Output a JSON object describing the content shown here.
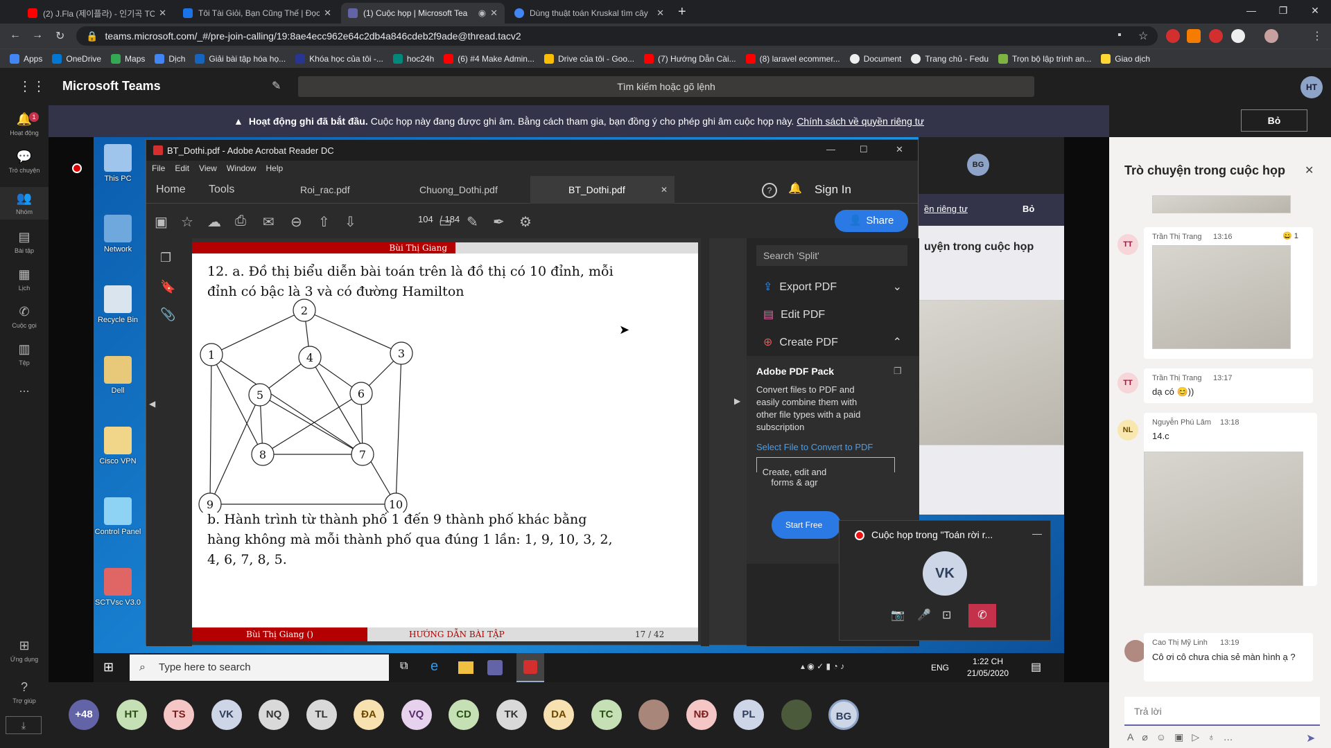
{
  "browser": {
    "tabs": [
      {
        "title": "(2) J.Fla (제이플라) - 인기곡 TOP",
        "icon": "youtube-icon",
        "color": "#ff0000"
      },
      {
        "title": "Tôi Tài Giỏi, Bạn Cũng Thế | Đọc",
        "icon": "s-site-icon",
        "color": "#1a73e8"
      },
      {
        "title": "(1) Cuộc họp | Microsoft Tea",
        "icon": "teams-icon",
        "color": "#6264a7"
      },
      {
        "title": "Dùng thuật toán Kruskal tìm cây",
        "icon": "google-icon",
        "color": "#4285f4"
      }
    ],
    "url": "teams.microsoft.com/_#/pre-join-calling/19:8ae4ecc962e64c2db4a846cdeb2f9ade@thread.tacv2",
    "bookmarks": [
      "Apps",
      "OneDrive",
      "Maps",
      "Dịch",
      "Giải bài tập hóa họ...",
      "Khóa học của tôi -...",
      "hoc24h",
      "(6) #4 Make Admin...",
      "Drive của tôi - Goo...",
      "(7) Hướng Dẫn Cài...",
      "(8) laravel ecommer...",
      "Document",
      "Trang chủ - Fedu",
      "Trọn bộ lập trình an...",
      "Giao dịch"
    ]
  },
  "teams": {
    "app_title": "Microsoft Teams",
    "search_placeholder": "Tìm kiếm hoặc gõ lệnh",
    "user_initials": "HT",
    "banner": {
      "bold": "Hoạt động ghi đã bắt đầu.",
      "text": "Cuộc họp này đang được ghi âm. Bằng cách tham gia, bạn đồng ý cho phép ghi âm cuộc họp này.",
      "link": "Chính sách về quyền riêng tư",
      "dismiss": "Bỏ"
    },
    "rail": [
      {
        "label": "Hoạt động",
        "badge": "1"
      },
      {
        "label": "Trò chuyện"
      },
      {
        "label": "Nhóm"
      },
      {
        "label": "Bài tập"
      },
      {
        "label": "Lịch"
      },
      {
        "label": "Cuộc gọi"
      },
      {
        "label": "Tệp"
      },
      {
        "label": "..."
      },
      {
        "label": "Ứng dụng"
      },
      {
        "label": "Trợ giúp"
      }
    ]
  },
  "desktop": {
    "icons": [
      "This PC",
      "Network",
      "Recycle Bin",
      "Dell",
      "Cisco VPN",
      "Control Panel",
      "SCTVsc V3.0"
    ]
  },
  "acrobat": {
    "window_title": "BT_Dothi.pdf - Adobe Acrobat Reader DC",
    "menu": [
      "File",
      "Edit",
      "View",
      "Window",
      "Help"
    ],
    "tabs": [
      "Home",
      "Tools",
      "Roi_rac.pdf",
      "Chuong_Dothi.pdf",
      "BT_Dothi.pdf"
    ],
    "sign_in": "Sign In",
    "share": "Share",
    "page_current": "104",
    "page_total": "/ 184",
    "page": {
      "header": "Bùi Thị Giang",
      "text_a": "12. a. Đồ thị biểu diễn bài toán trên là đồ thị có 10 đỉnh, mỗi đỉnh có bậc là 3 và có đường Hamilton",
      "text_b": "b. Hành trình từ thành phố 1 đến 9 thành phố khác bằng hàng không mà mỗi thành phố qua đúng 1 lần: 1, 9, 10, 3, 2, 4, 6, 7, 8, 5.",
      "footer_author": "Bùi Thị Giang ()",
      "footer_title": "HƯỚNG DẪN BÀI TẬP",
      "footer_page": "17 / 42",
      "nodes": [
        "2",
        "1",
        "4",
        "3",
        "5",
        "6",
        "8",
        "7",
        "9",
        "10"
      ]
    },
    "right_pane": {
      "search_placeholder": "Search 'Split'",
      "items": [
        "Export PDF",
        "Edit PDF",
        "Create PDF"
      ],
      "pack_title": "Adobe PDF Pack",
      "pack_text": "Convert files to PDF and easily combine them with other file types with a paid subscription",
      "select_link": "Select File to Convert to PDF",
      "bottom_text": "Create, edit and forms & agr",
      "start_button": "Start Free"
    }
  },
  "minicall": {
    "title": "Cuộc họp trong \"Toán rời r...",
    "initials": "VK"
  },
  "bg_meeting": {
    "privacy_link": "ền riêng tư",
    "dismiss": "Bỏ",
    "chat_title": "uyện trong cuộc họp",
    "avatar": "BG"
  },
  "taskbar": {
    "search": "Type here to search",
    "lang": "ENG",
    "time": "1:22 CH",
    "date": "21/05/2020"
  },
  "chat": {
    "title": "Trò chuyện trong cuộc họp",
    "messages": [
      {
        "initials": "TT",
        "name": "Trần Thị Trang",
        "time": "13:16",
        "reaction": "1",
        "text": ""
      },
      {
        "initials": "TT",
        "name": "Trần Thị Trang",
        "time": "13:17",
        "reaction": "",
        "text": "dạ có"
      },
      {
        "initials": "NL",
        "name": "Nguyễn Phú Lâm",
        "time": "13:18",
        "reaction": "",
        "text": "14.c"
      },
      {
        "initials": "",
        "name": "Cao Thị Mỹ Linh",
        "time": "13:19",
        "reaction": "",
        "text": "Cô ơi cô chưa chia sẻ màn hình ạ ?"
      }
    ],
    "reply_placeholder": "Trả lời"
  },
  "participants": [
    {
      "label": "+48",
      "bg": "#6264a7",
      "fg": "#ffffff"
    },
    {
      "label": "HT",
      "bg": "#c5e0b4",
      "fg": "#2b5016"
    },
    {
      "label": "TS",
      "bg": "#f4c6c6",
      "fg": "#7a1f1f"
    },
    {
      "label": "VK",
      "bg": "#cdd6e6",
      "fg": "#2f3e5c"
    },
    {
      "label": "NQ",
      "bg": "#d9d9d9",
      "fg": "#333333"
    },
    {
      "label": "TL",
      "bg": "#d9d9d9",
      "fg": "#333333"
    },
    {
      "label": "ĐA",
      "bg": "#f8e1b0",
      "fg": "#6b4a00"
    },
    {
      "label": "VQ",
      "bg": "#e6d2ec",
      "fg": "#5a2b6b"
    },
    {
      "label": "CD",
      "bg": "#c5e0b4",
      "fg": "#2b5016"
    },
    {
      "label": "TK",
      "bg": "#d9d9d9",
      "fg": "#333333"
    },
    {
      "label": "DA",
      "bg": "#f8e1b0",
      "fg": "#6b4a00"
    },
    {
      "label": "TC",
      "bg": "#c5e0b4",
      "fg": "#2b5016"
    },
    {
      "label": "",
      "bg": "#a8877a",
      "fg": "#ffffff"
    },
    {
      "label": "NĐ",
      "bg": "#f4c6c6",
      "fg": "#7a1f1f"
    },
    {
      "label": "PL",
      "bg": "#cdd6e6",
      "fg": "#2f3e5c"
    },
    {
      "label": "",
      "bg": "#4a5a3a",
      "fg": "#ffffff"
    },
    {
      "label": "BG",
      "bg": "#cdd6e6",
      "fg": "#2f3e5c"
    }
  ]
}
